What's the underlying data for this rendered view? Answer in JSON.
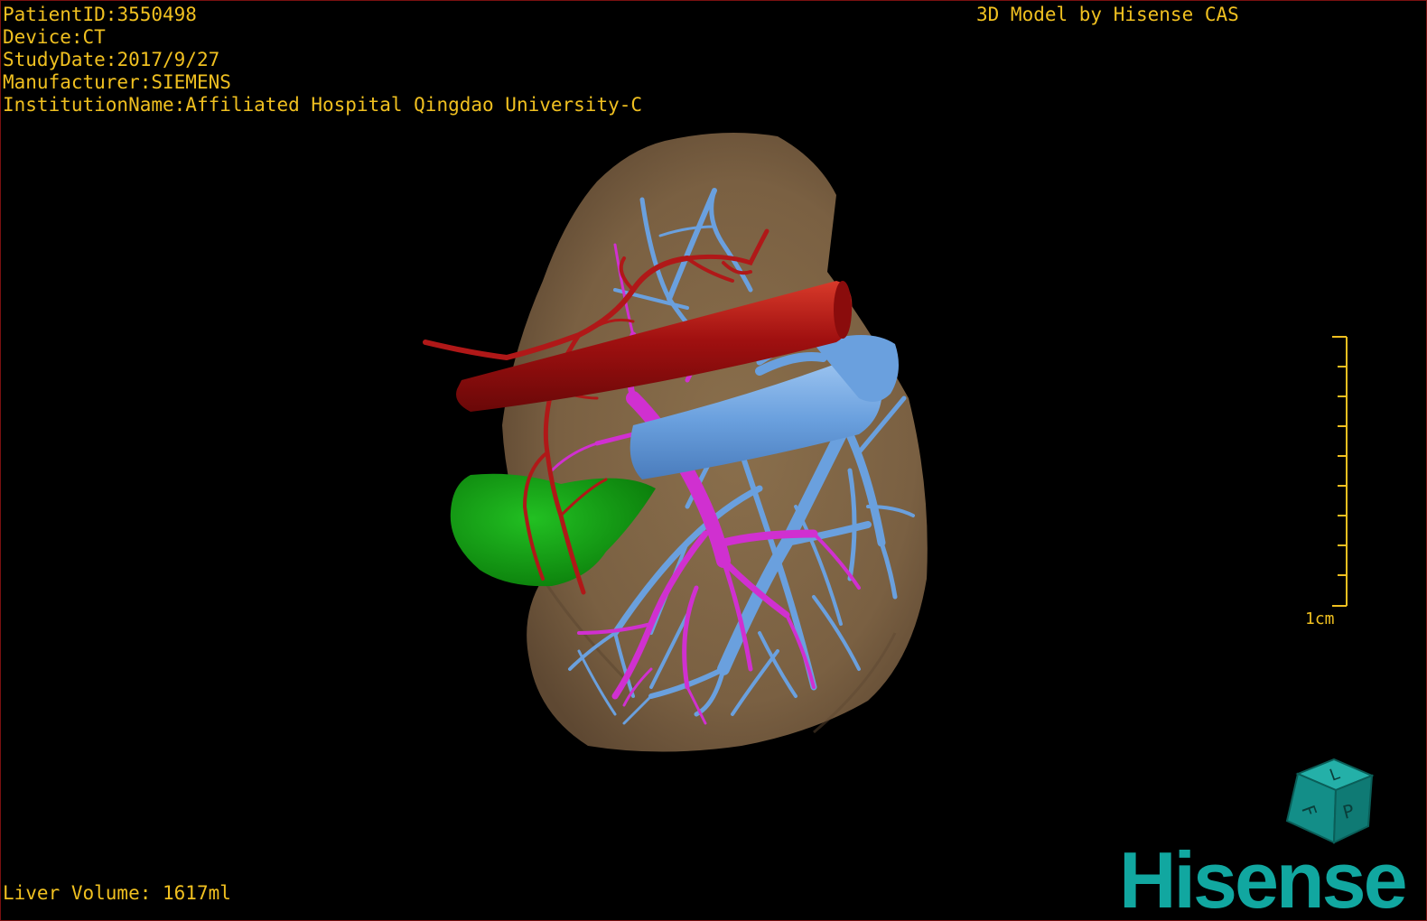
{
  "patient_info": {
    "patient_id_label": "PatientID:",
    "patient_id": "3550498",
    "device_label": "Device:",
    "device": "CT",
    "study_date_label": "StudyDate:",
    "study_date": "2017/9/27",
    "manufacturer_label": "Manufacturer:",
    "manufacturer": "SIEMENS",
    "institution_label": "InstitutionName:",
    "institution": "Affiliated Hospital Qingdao University-C"
  },
  "header": {
    "model_title": "3D Model by Hisense CAS"
  },
  "footer": {
    "liver_volume_label": "Liver Volume: ",
    "liver_volume": "1617ml"
  },
  "scale_bar": {
    "label": "1cm"
  },
  "orientation_cube": {
    "face_front": "F",
    "face_right": "P",
    "face_top": "L"
  },
  "brand": {
    "logo_text": "Hisense"
  },
  "colors": {
    "overlay_text": "#f0c020",
    "liver": "#7e6444",
    "artery": "#b01818",
    "portal_vein": "#d030d0",
    "hepatic_vein": "#6aa0de",
    "gallbladder": "#12a012",
    "brand": "#11a7a0",
    "frame_border": "#7a1010"
  },
  "icons": {
    "orientation_cube": "orientation-cube-icon",
    "scale_bar": "scale-bar-icon"
  }
}
